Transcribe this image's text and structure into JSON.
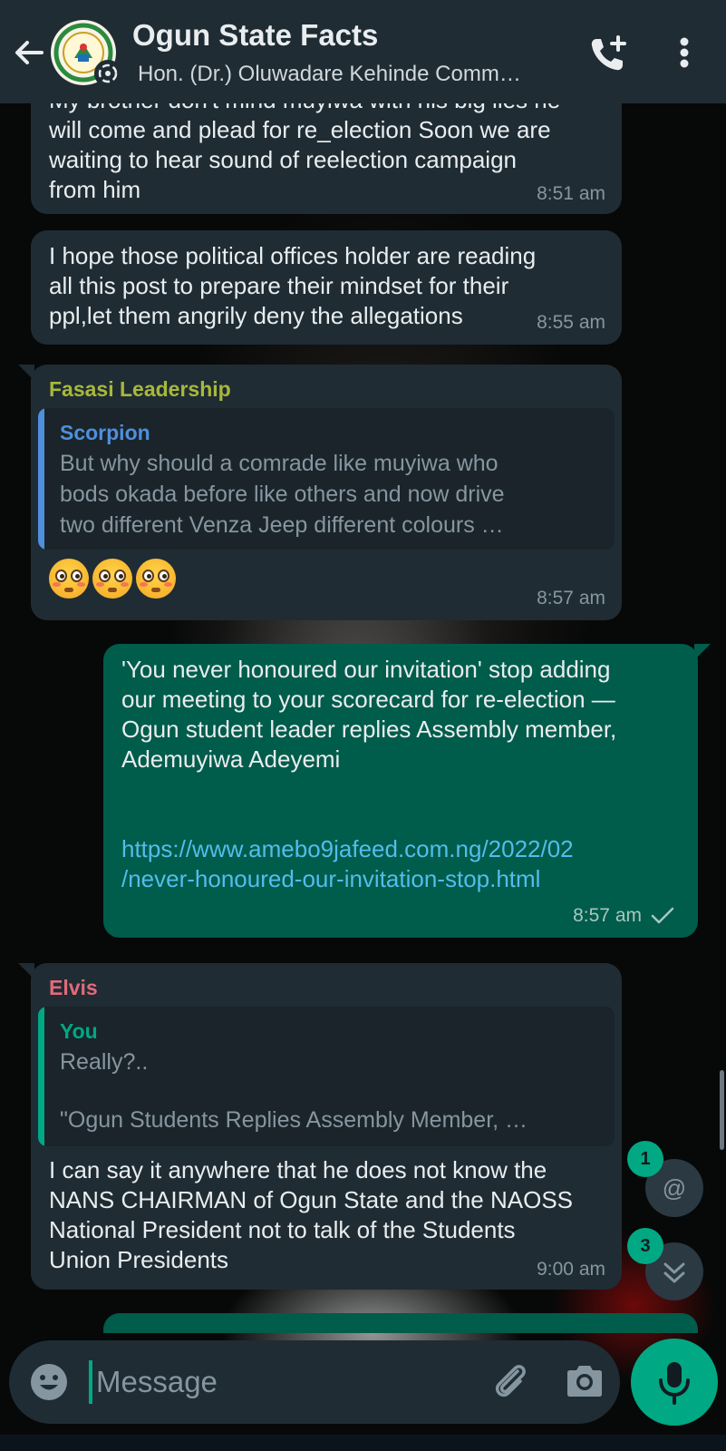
{
  "header": {
    "title": "Ogun State Facts",
    "subtitle": "Hon. (Dr.) Oluwadare Kehinde  Comm…",
    "avatar_text": "OGUN STATE NIGERIA"
  },
  "messages": [
    {
      "text_lines": [
        "My brother don't mind muyiwa with his big lies he",
        "will come and plead for re_election Soon we are",
        "waiting to hear sound of reelection campaign",
        "from him"
      ],
      "time": "8:51 am"
    },
    {
      "text_lines": [
        "I hope those political offices holder are reading",
        "all this post to prepare their mindset for their",
        "ppl,let them angrily deny the allegations"
      ],
      "time": "8:55 am"
    },
    {
      "sender": "Fasasi Leadership",
      "quote_author": "Scorpion",
      "quote_lines": [
        "But why should a comrade like muyiwa who",
        "bods okada before like others and now drive",
        "two different Venza Jeep  different colours …"
      ],
      "emoji": "😳😳😳",
      "time": "8:57 am"
    },
    {
      "outgoing": true,
      "text_lines": [
        "'You never honoured our invitation' stop adding",
        "our meeting to your scorecard for re-election —",
        "Ogun student leader replies Assembly member,",
        "Ademuyiwa Adeyemi"
      ],
      "link_lines": [
        "https://www.amebo9jafeed.com.ng/2022/02",
        "/never-honoured-our-invitation-stop.html"
      ],
      "time": "8:57 am"
    },
    {
      "sender": "Elvis",
      "quote_author": "You",
      "quote_lines": [
        "Really?..",
        "",
        "\"Ogun Students Replies Assembly Member, …"
      ],
      "text_lines": [
        "I can say it anywhere that he does not know the",
        "NANS CHAIRMAN of Ogun State and the NAOSS",
        "National President not to talk of the Students",
        "Union Presidents"
      ],
      "time": "9:00 am"
    }
  ],
  "fabs": {
    "mention_badge": "1",
    "mention_symbol": "@",
    "scroll_badge": "3"
  },
  "composer": {
    "placeholder": "Message"
  },
  "colors": {
    "header_bg": "#1f2c34",
    "incoming_bubble": "#1f2c34",
    "outgoing_bubble": "#005c4b",
    "accent": "#00a884",
    "link": "#53bdeb",
    "sender_fasasi": "#a8b83a",
    "sender_elvis": "#e26a7a",
    "quote_scorpion": "#4f8fdc",
    "quote_you": "#00a884"
  }
}
